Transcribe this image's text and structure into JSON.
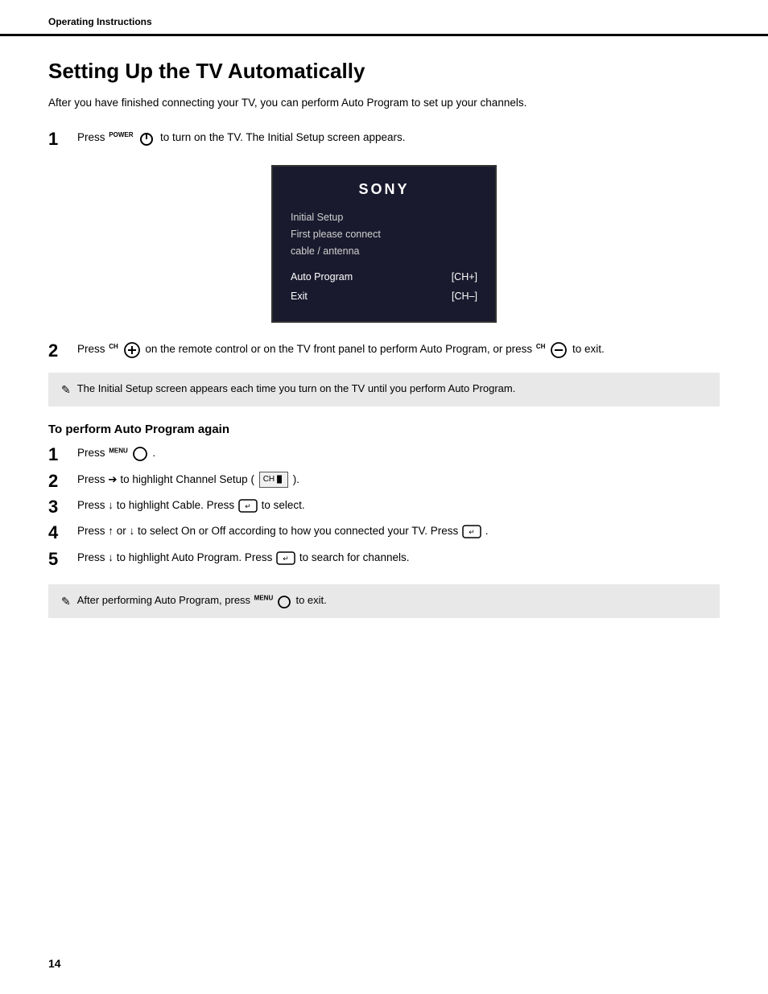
{
  "header": {
    "label": "Operating Instructions"
  },
  "page": {
    "title": "Setting Up the TV Automatically",
    "intro": "After you have finished connecting your TV, you can perform Auto Program to set up your channels.",
    "steps": [
      {
        "number": "1",
        "text_before": "Press",
        "icon": "power",
        "text_after": "to turn on the TV. The Initial Setup screen appears."
      },
      {
        "number": "2",
        "text_before": "Press",
        "icon": "ch-plus",
        "text_middle": "on the remote control or on the TV front panel to perform Auto Program, or press",
        "icon2": "ch-minus",
        "text_after": "to exit."
      }
    ],
    "tv_screen": {
      "brand": "SONY",
      "lines": [
        "Initial Setup",
        "First please connect",
        "cable / antenna"
      ],
      "menu": [
        {
          "label": "Auto Program",
          "key": "[CH+]"
        },
        {
          "label": "Exit",
          "key": "[CH–]"
        }
      ]
    },
    "note1": "The Initial Setup screen appears each time you turn on the TV until you perform Auto Program.",
    "subsection_title": "To perform Auto Program again",
    "substeps": [
      {
        "number": "1",
        "text": "Press"
      },
      {
        "number": "2",
        "text": "Press ➔ to highlight Channel Setup ("
      },
      {
        "number": "3",
        "text": "Press ↓ to highlight Cable. Press ↩ to select."
      },
      {
        "number": "4",
        "text": "Press ↑ or ↓ to select On or Off according to how you connected your TV. Press ↩."
      },
      {
        "number": "5",
        "text": "Press ↓ to highlight Auto Program. Press ↩ to search for channels."
      }
    ],
    "note2_before": "After performing Auto Program, press",
    "note2_after": "to exit.",
    "page_number": "14"
  }
}
